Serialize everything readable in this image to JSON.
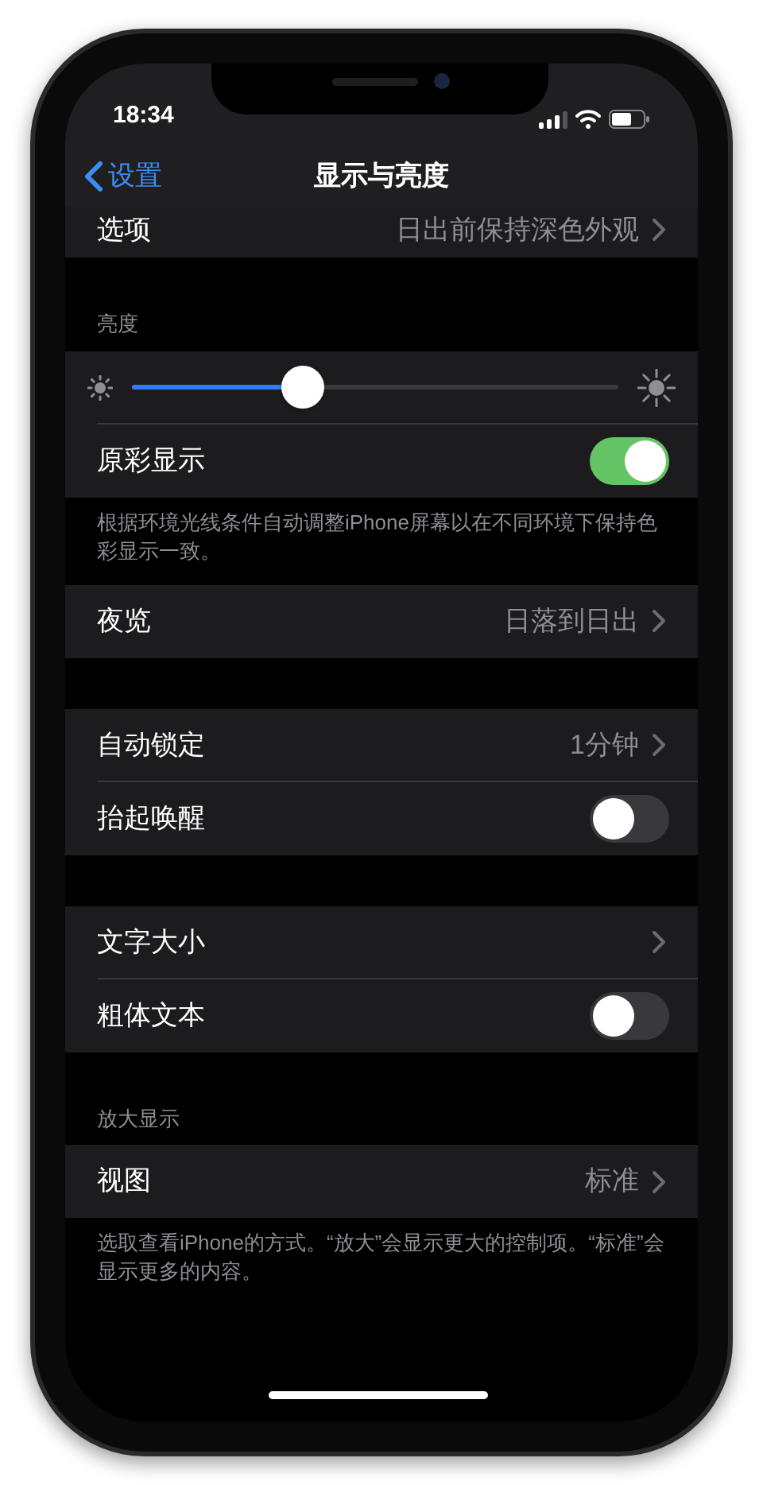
{
  "status_bar": {
    "time": "18:34"
  },
  "nav": {
    "back": "设置",
    "title": "显示与亮度"
  },
  "sections": [
    {
      "rows": [
        {
          "kind": "value",
          "label": "选项",
          "value": "日出前保持深色外观"
        }
      ]
    },
    {
      "header": "亮度",
      "rows": [
        {
          "kind": "slider",
          "level": 0.35
        },
        {
          "kind": "toggle",
          "label": "原彩显示",
          "on": true
        }
      ],
      "footer": "根据环境光线条件自动调整iPhone屏幕以在不同环境下保持色彩显示一致。"
    },
    {
      "rows": [
        {
          "kind": "value",
          "label": "夜览",
          "value": "日落到日出"
        }
      ]
    },
    {
      "rows": [
        {
          "kind": "value",
          "label": "自动锁定",
          "value": "1分钟"
        },
        {
          "kind": "toggle",
          "label": "抬起唤醒",
          "on": false
        }
      ]
    },
    {
      "rows": [
        {
          "kind": "value",
          "label": "文字大小"
        },
        {
          "kind": "toggle",
          "label": "粗体文本",
          "on": false
        }
      ]
    },
    {
      "header": "放大显示",
      "rows": [
        {
          "kind": "value",
          "label": "视图",
          "value": "标准"
        }
      ],
      "footer": "选取查看iPhone的方式。“放大”会显示更大的控制项。“标准”会显示更多的内容。"
    }
  ]
}
